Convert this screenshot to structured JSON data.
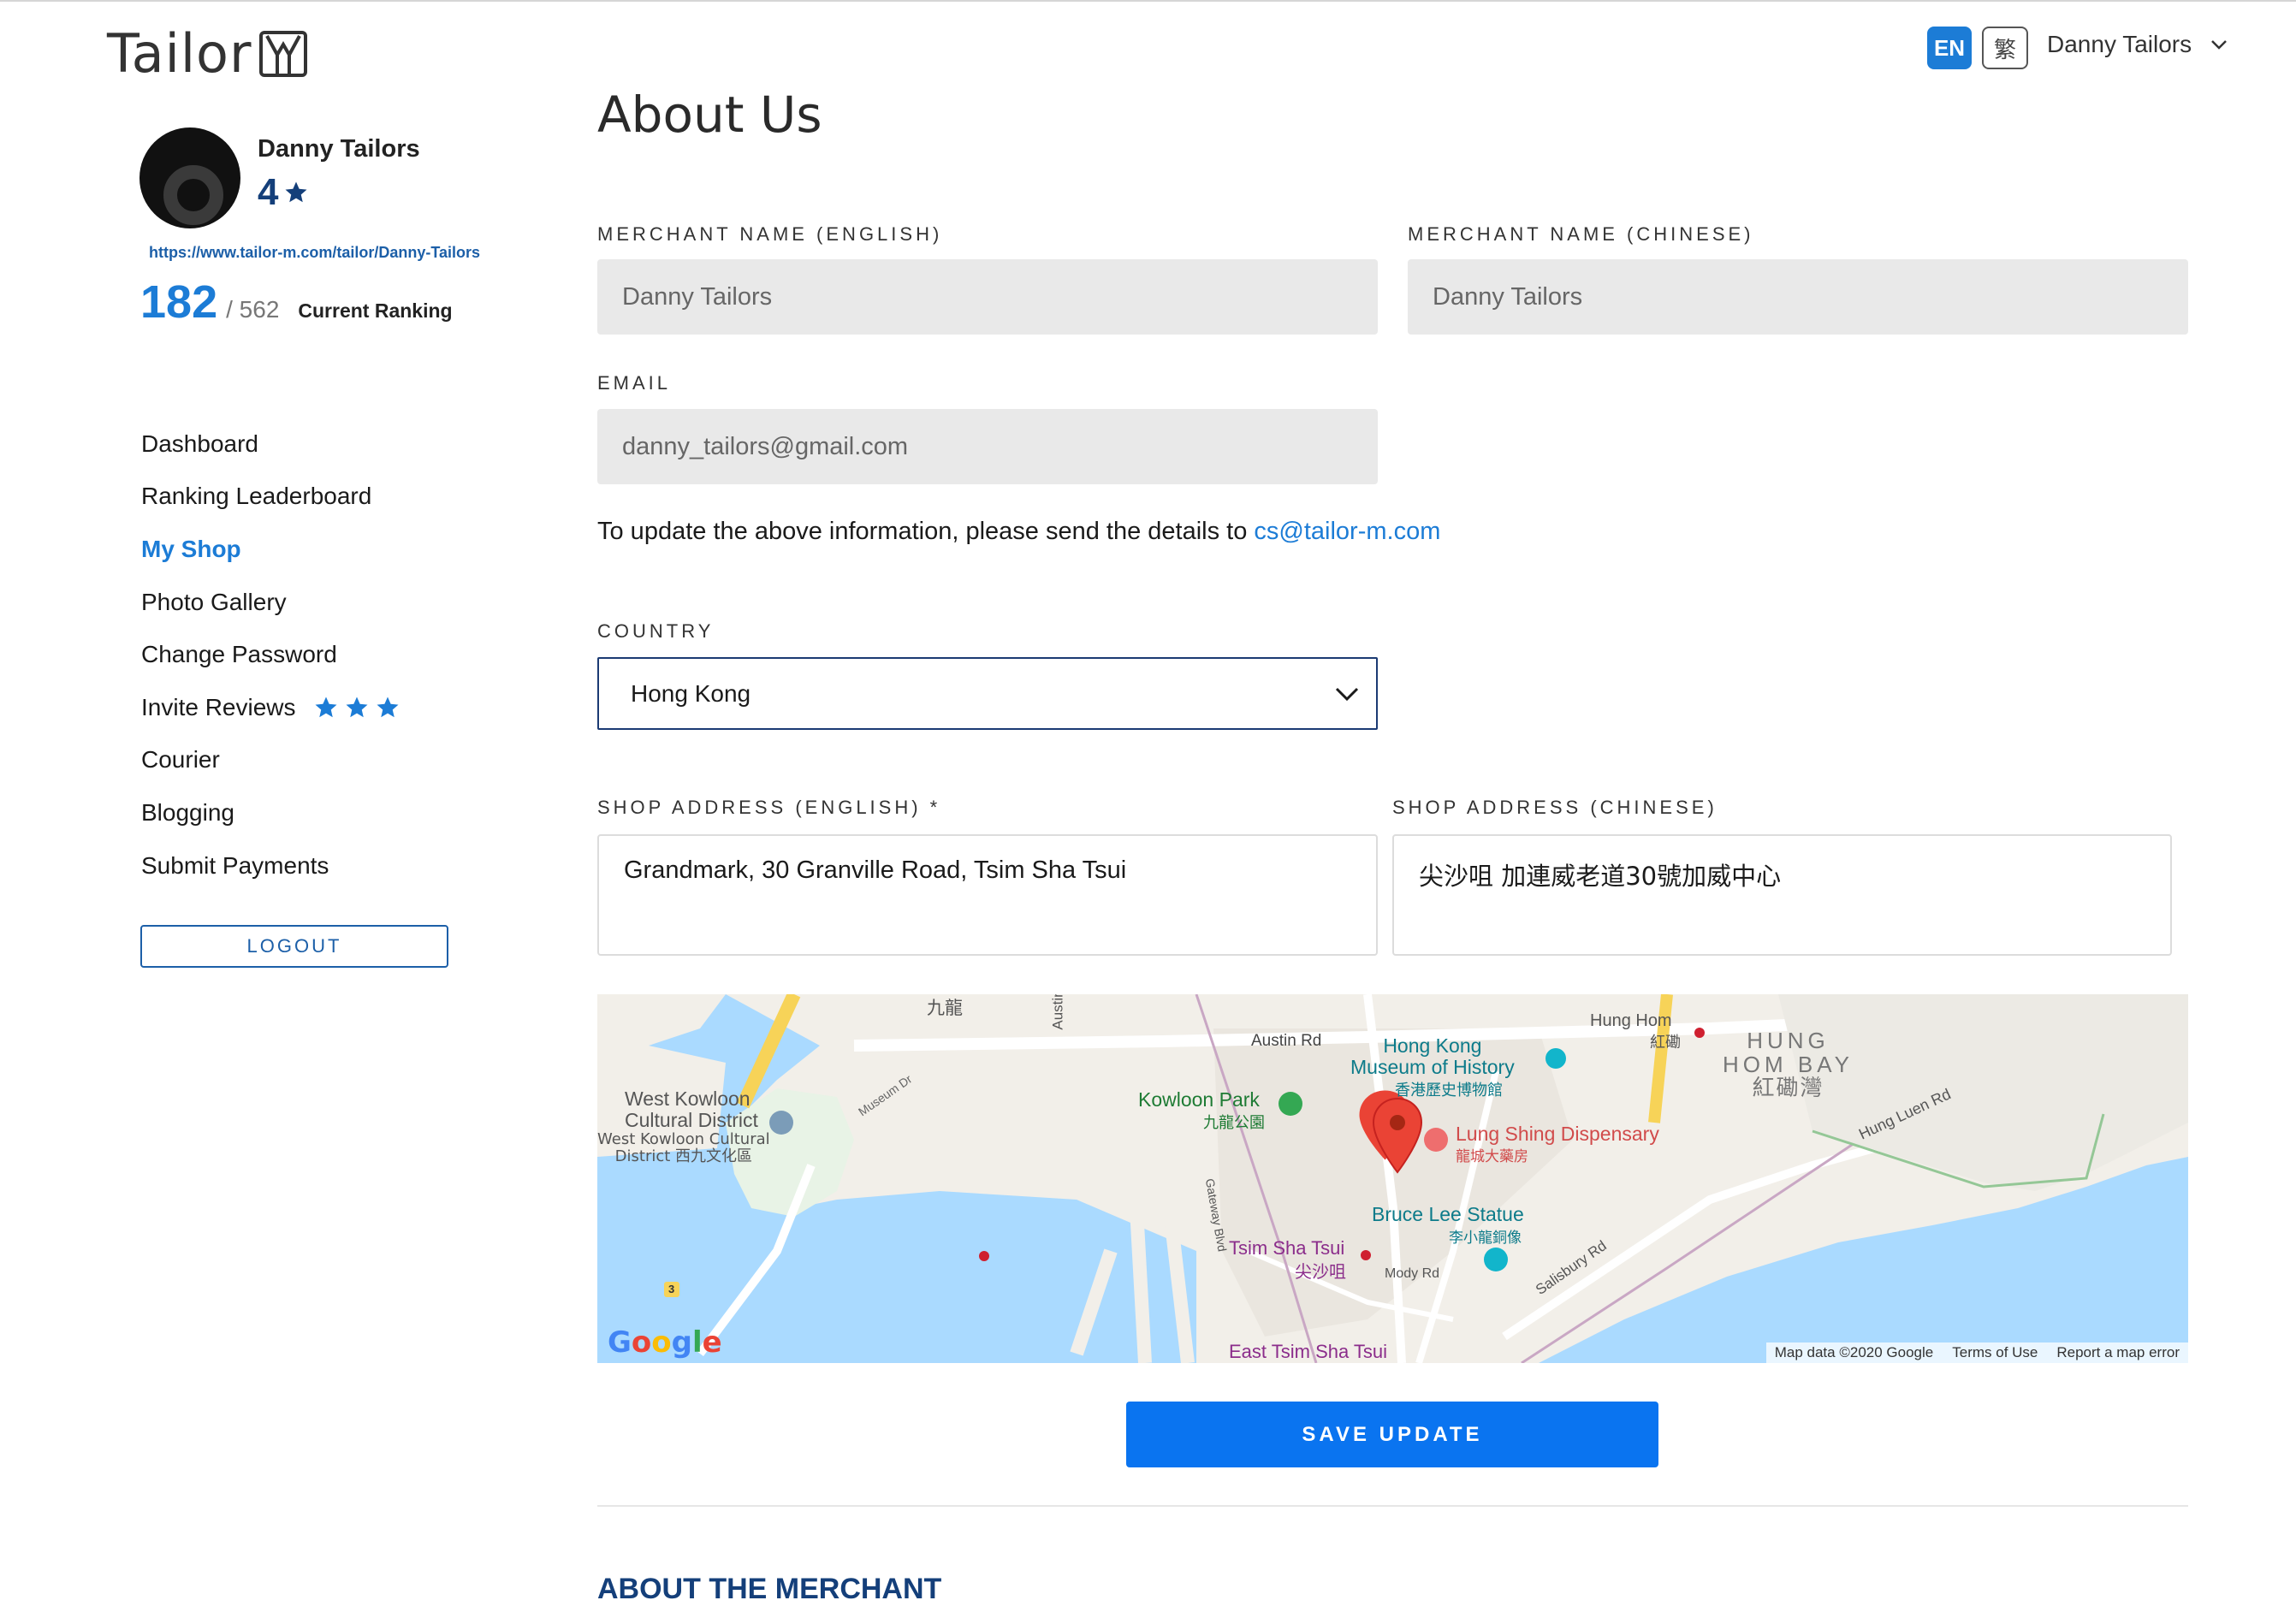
{
  "header": {
    "logo_text": "Tailor",
    "logo_icon": "suit-jacket-icon",
    "lang_en": "EN",
    "lang_zh": "繁",
    "user_name": "Danny Tailors"
  },
  "profile": {
    "name": "Danny Tailors",
    "rating": "4",
    "url": "https://www.tailor-m.com/tailor/Danny-Tailors",
    "rank": "182",
    "rank_total": "/ 562",
    "rank_label": "Current Ranking"
  },
  "nav": {
    "items": [
      {
        "label": "Dashboard"
      },
      {
        "label": "Ranking Leaderboard"
      },
      {
        "label": "My Shop"
      },
      {
        "label": "Photo Gallery"
      },
      {
        "label": "Change Password"
      },
      {
        "label": "Invite Reviews"
      },
      {
        "label": "Courier"
      },
      {
        "label": "Blogging"
      },
      {
        "label": "Submit Payments"
      }
    ],
    "active_index": 2,
    "invite_star_count": 3,
    "logout_label": "LOGOUT"
  },
  "colors": {
    "accent": "#1c7cd6",
    "dark_navy": "#143f7a",
    "button_blue": "#0a74f0"
  },
  "form": {
    "title": "About Us",
    "merchant_name_en_label": "MERCHANT NAME (ENGLISH)",
    "merchant_name_en_value": "Danny Tailors",
    "merchant_name_zh_label": "MERCHANT NAME (CHINESE)",
    "merchant_name_zh_value": "Danny Tailors",
    "email_label": "EMAIL",
    "email_value": "danny_tailors@gmail.com",
    "info_text": "To update the above information, please send the details to ",
    "info_email": "cs@tailor-m.com",
    "country_label": "COUNTRY",
    "country_value": "Hong Kong",
    "address_en_label": "SHOP ADDRESS (ENGLISH) *",
    "address_en_value": "Grandmark, 30 Granville Road, Tsim Sha Tsui",
    "address_zh_label": "SHOP ADDRESS (CHINESE)",
    "address_zh_value": "尖沙咀 加連威老道30號加威中心",
    "save_label": "SAVE UPDATE"
  },
  "map": {
    "labels": {
      "kowloon_zh": "九龍",
      "austin": "Austin",
      "austin_rd": "Austin Rd",
      "west_kowloon_1": "West Kowloon",
      "west_kowloon_2": "Cultural District",
      "west_kowloon_3": "West Kowloon Cultural",
      "west_kowloon_4": "District 西九文化區",
      "museum_dr": "Museum Dr",
      "kowloon_park": "Kowloon Park",
      "kowloon_park_zh": "九龍公園",
      "hk_museum_1": "Hong Kong",
      "hk_museum_2": "Museum of History",
      "hk_museum_zh": "香港歷史博物館",
      "lung_sing": "Lung Shing Dispensary",
      "lung_sing_zh": "龍城大藥房",
      "hung_hom": "Hung Hom",
      "hung_hom_zh": "紅磡",
      "hung_hom_bay_1": "HUNG",
      "hung_hom_bay_2": "HOM BAY",
      "hung_hom_bay_zh": "紅磡灣",
      "hung_luen_rd": "Hung Luen Rd",
      "bruce_lee": "Bruce Lee Statue",
      "bruce_lee_zh": "李小龍銅像",
      "tst": "Tsim Sha Tsui",
      "tst_zh": "尖沙咀",
      "mody_rd": "Mody Rd",
      "salisbury_rd": "Salisbury Rd",
      "gateway_blvd": "Gateway Blvd",
      "east_tst": "East Tsim Sha Tsui",
      "route_3": "3"
    },
    "google": [
      "G",
      "o",
      "o",
      "g",
      "l",
      "e"
    ],
    "attribution": [
      "Map data ©2020 Google",
      "Terms of Use",
      "Report a map error"
    ]
  },
  "about_section_title": "ABOUT THE MERCHANT"
}
